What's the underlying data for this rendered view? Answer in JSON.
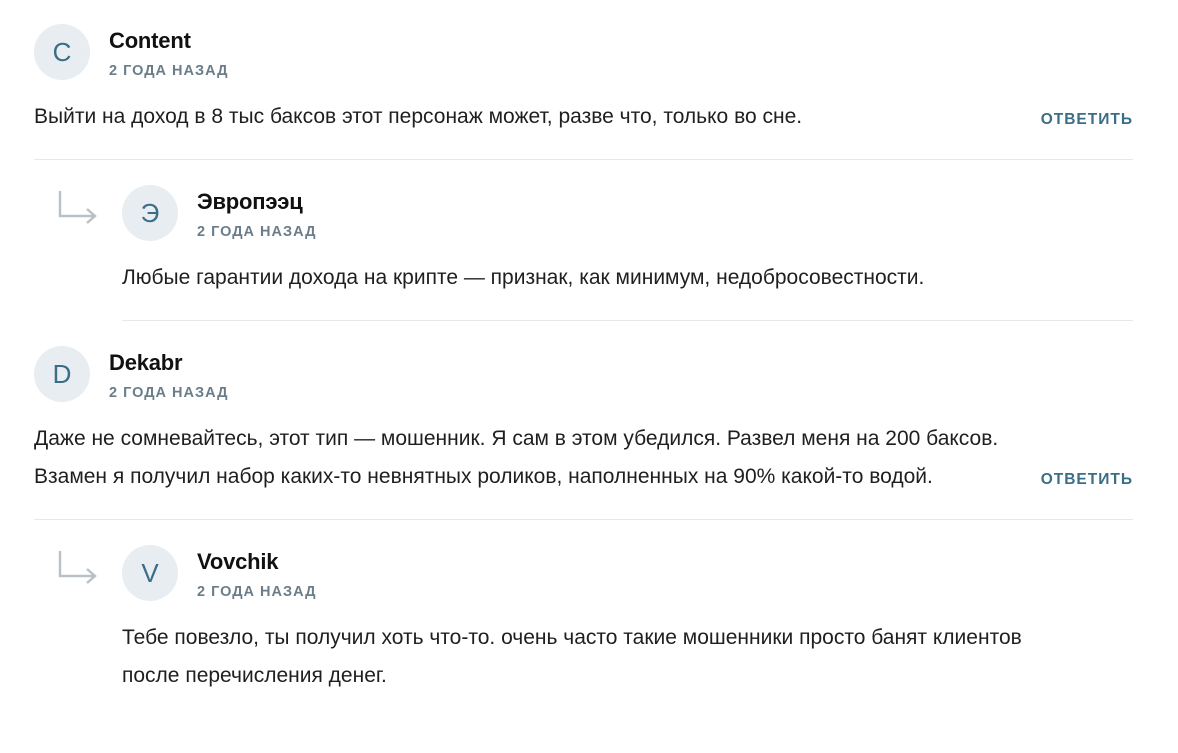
{
  "comments": [
    {
      "avatar_letter": "C",
      "author": "Content",
      "time": "2 ГОДА НАЗАД",
      "text": "Выйти на доход в 8 тыс баксов этот персонаж может, разве что, только во сне.",
      "reply_label": "ОТВЕТИТЬ"
    },
    {
      "avatar_letter": "Э",
      "author": "Эвропээц",
      "time": "2 ГОДА НАЗАД",
      "text": "Любые гарантии дохода на крипте — признак, как минимум, недобросовестности."
    },
    {
      "avatar_letter": "D",
      "author": "Dekabr",
      "time": "2 ГОДА НАЗАД",
      "text": "Даже не сомневайтесь, этот тип — мошенник. Я сам в этом убедился. Развел меня на 200 баксов. Взамен я получил набор каких-то невнятных роликов, наполненных на 90% какой-то водой.",
      "reply_label": "ОТВЕТИТЬ"
    },
    {
      "avatar_letter": "V",
      "author": "Vovchik",
      "time": "2 ГОДА НАЗАД",
      "text": "Тебе повезло, ты получил хоть что-то. очень часто такие мошенники просто банят клиентов после перечисления денег."
    }
  ],
  "colors": {
    "accent": "#3a6d86",
    "avatar_bg": "#e8edf1",
    "meta": "#6a7d89",
    "divider": "#e6e9ec"
  },
  "icons": {
    "reply_indicator": "reply-arrow-icon"
  }
}
